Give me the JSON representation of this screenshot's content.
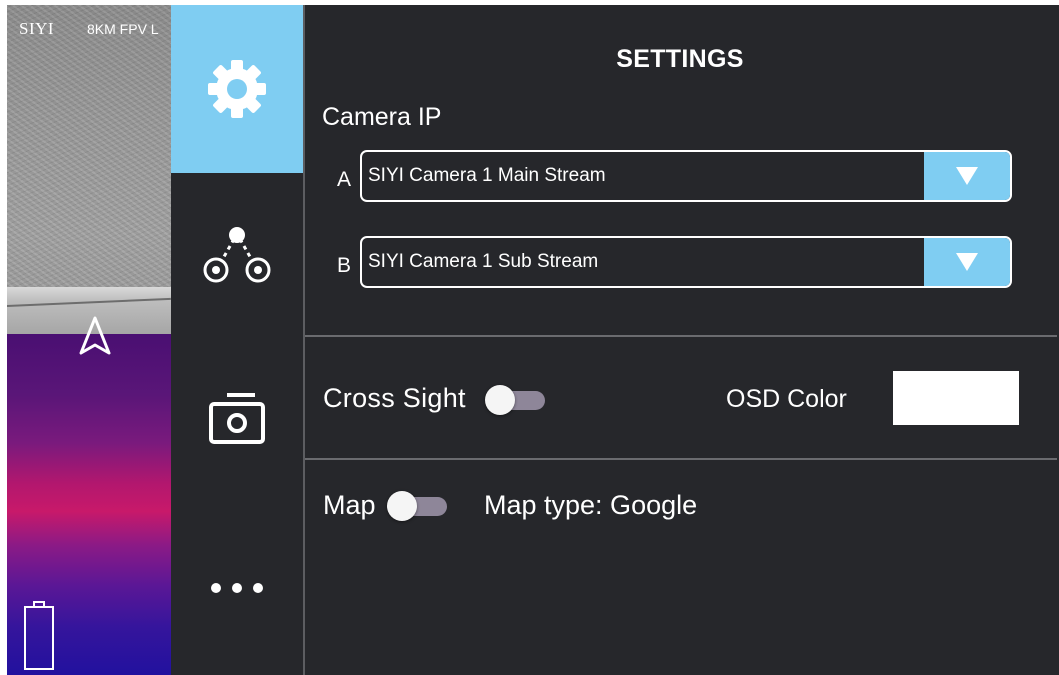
{
  "preview": {
    "brand": "SIYI",
    "brand_sub": "8KM FPV L",
    "icons": [
      "navigation-arrow-icon",
      "battery-icon"
    ]
  },
  "sidebar": {
    "items": [
      {
        "id": "settings",
        "icon": "gear-icon",
        "active": true
      },
      {
        "id": "link",
        "icon": "link-nodes-icon",
        "active": false
      },
      {
        "id": "camera",
        "icon": "camera-icon",
        "active": false
      },
      {
        "id": "more",
        "icon": "more-dots-icon",
        "active": false
      }
    ]
  },
  "settings": {
    "title": "SETTINGS",
    "camera_ip_label": "Camera IP",
    "streams": [
      {
        "letter": "A",
        "value": "SIYI Camera 1 Main Stream"
      },
      {
        "letter": "B",
        "value": "SIYI Camera 1 Sub Stream"
      }
    ],
    "cross_sight_label": "Cross Sight",
    "cross_sight_on": false,
    "osd_color_label": "OSD Color",
    "osd_color": "#ffffff",
    "map_label": "Map",
    "map_on": false,
    "map_type": "Map type: Google"
  },
  "colors": {
    "accent": "#7fcdf2",
    "panel_bg": "#26272b",
    "toggle_track": "#8e8699"
  }
}
